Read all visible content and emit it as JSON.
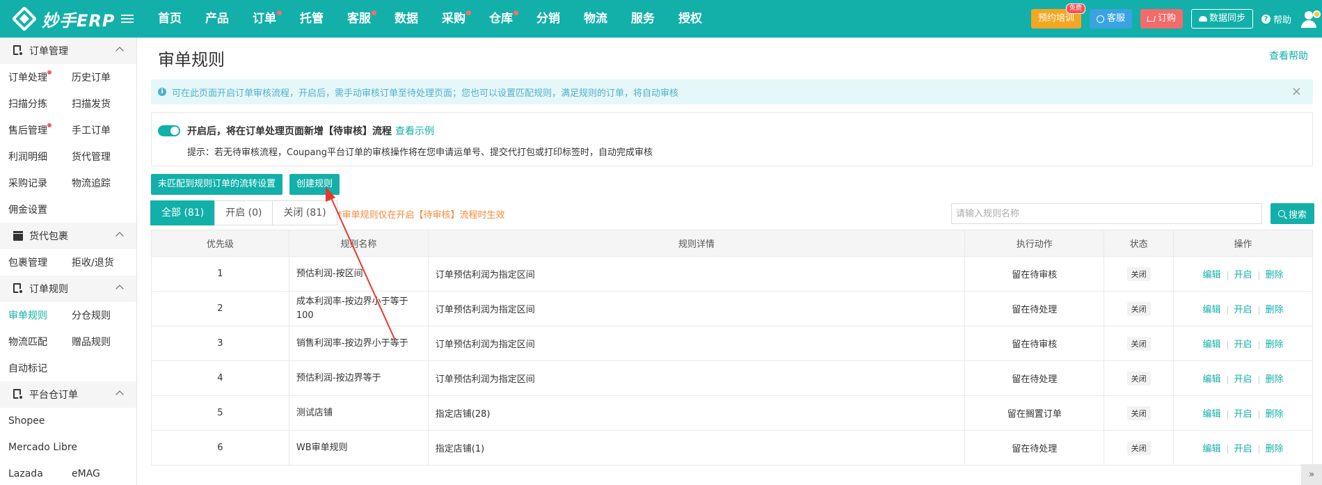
{
  "header": {
    "logo_text": "妙手ERP",
    "nav": [
      {
        "label": "首页",
        "dot": false
      },
      {
        "label": "产品",
        "dot": false
      },
      {
        "label": "订单",
        "dot": true
      },
      {
        "label": "托管",
        "dot": false
      },
      {
        "label": "客服",
        "dot": true
      },
      {
        "label": "数据",
        "dot": false
      },
      {
        "label": "采购",
        "dot": true
      },
      {
        "label": "仓库",
        "dot": true
      },
      {
        "label": "分销",
        "dot": false
      },
      {
        "label": "物流",
        "dot": false
      },
      {
        "label": "服务",
        "dot": false
      },
      {
        "label": "授权",
        "dot": false
      }
    ],
    "training_label": "预约培训",
    "free_badge": "免费",
    "service_label": "客服",
    "order_label": "订购",
    "sync_label": "数据同步",
    "help_label": "帮助"
  },
  "sidebar": {
    "groups": [
      {
        "title": "订单管理",
        "icon": "order-doc-icon",
        "rows": [
          [
            "订单处理",
            "历史订单"
          ],
          [
            "扫描分拣",
            "扫描发货"
          ],
          [
            "售后管理",
            "手工订单"
          ],
          [
            "利润明细",
            "货代管理"
          ],
          [
            "采购记录",
            "物流追踪"
          ],
          [
            "佣金设置"
          ]
        ]
      },
      {
        "title": "货代包裹",
        "icon": "package-icon",
        "rows": [
          [
            "包裹管理",
            "拒收/退货"
          ]
        ]
      },
      {
        "title": "订单规则",
        "icon": "rule-doc-icon",
        "rows": [
          [
            "审单规则",
            "分仓规则"
          ],
          [
            "物流匹配",
            "赠品规则"
          ],
          [
            "自动标记"
          ]
        ]
      },
      {
        "title": "平台仓订单",
        "icon": "warehouse-icon",
        "rows": [
          [
            "Shopee"
          ],
          [
            "Mercado Libre"
          ],
          [
            "Lazada",
            "eMAG"
          ]
        ]
      }
    ],
    "active_item": "审单规则",
    "dotted_items": [
      "订单处理",
      "售后管理"
    ]
  },
  "main": {
    "title": "审单规则",
    "help_link": "查看帮助",
    "info": "可在此页面开启订单审核流程，开启后，需手动审核订单至待处理页面；您也可以设置匹配规则，满足规则的订单，将自动审核",
    "switch_label": "开启后，将在订单处理页面新增【待审核】流程",
    "switch_link": "查看示例",
    "switch_hint": "提示：若无待审核流程，Coupang平台订单的审核操作将在您申请运单号、提交代打包或打印标签时，自动完成审核",
    "btn_unmatched": "未匹配到规则订单的流转设置",
    "btn_create": "创建规则",
    "tabs": [
      "全部 (81)",
      "开启 (0)",
      "关闭 (81)"
    ],
    "tabs_note": "*审单规则仅在开启【待审核】流程时生效",
    "search_placeholder": "请输入规则名称",
    "search_btn": "搜索",
    "table": {
      "columns": [
        "优先级",
        "规则名称",
        "规则详情",
        "执行动作",
        "状态",
        "操作"
      ],
      "rows": [
        {
          "priority": "1",
          "name": "预估利润-按区间",
          "detail": "订单预估利润为指定区间",
          "action": "留在待审核",
          "status": "关闭"
        },
        {
          "priority": "2",
          "name": "成本利润率-按边界小于等于100",
          "detail": "订单预估利润为指定区间",
          "action": "留在待处理",
          "status": "关闭"
        },
        {
          "priority": "3",
          "name": "销售利润率-按边界小于等于",
          "detail": "订单预估利润为指定区间",
          "action": "留在待审核",
          "status": "关闭"
        },
        {
          "priority": "4",
          "name": "预估利润-按边界等于",
          "detail": "订单预估利润为指定区间",
          "action": "留在待处理",
          "status": "关闭"
        },
        {
          "priority": "5",
          "name": "测试店铺",
          "detail": "指定店铺(28)",
          "action": "留在搁置订单",
          "status": "关闭"
        },
        {
          "priority": "6",
          "name": "WB审单规则",
          "detail": "指定店铺(1)",
          "action": "留在待处理",
          "status": "关闭"
        }
      ],
      "ops": [
        "编辑",
        "开启",
        "删除"
      ]
    }
  },
  "colors": {
    "primary": "#12b0a9",
    "warning_text": "#f5893a",
    "arrow": "#e8372c"
  }
}
